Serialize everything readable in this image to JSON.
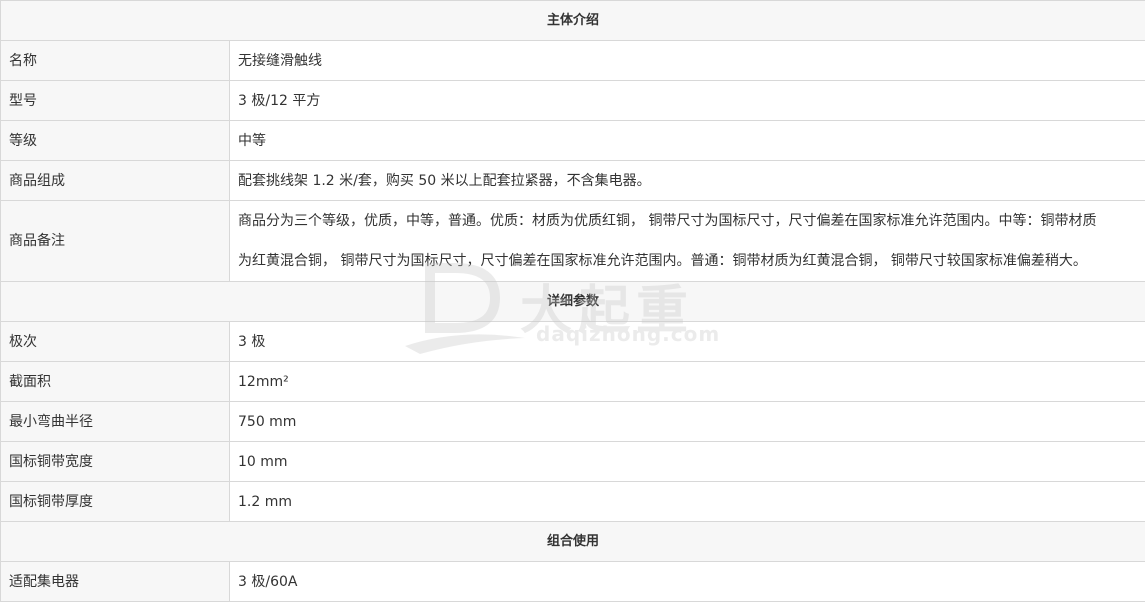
{
  "sections": {
    "intro_title": "主体介绍",
    "params_title": "详细参数",
    "combo_title": "组合使用"
  },
  "intro": {
    "name_label": "名称",
    "name_value": "无接缝滑触线",
    "model_label": "型号",
    "model_value": "3 极/12 平方",
    "grade_label": "等级",
    "grade_value": "中等",
    "composition_label": "商品组成",
    "composition_value": "配套挑线架 1.2 米/套，购买 50 米以上配套拉紧器，不含集电器。",
    "remarks_label": "商品备注",
    "remarks_line1": "商品分为三个等级，优质，中等，普通。优质：材质为优质红铜， 铜带尺寸为国标尺寸，尺寸偏差在国家标准允许范围内。中等：铜带材质",
    "remarks_line2": "为红黄混合铜， 铜带尺寸为国标尺寸，尺寸偏差在国家标准允许范围内。普通：铜带材质为红黄混合铜， 铜带尺寸较国家标准偏差稍大。"
  },
  "params": {
    "poles_label": "极次",
    "poles_value": "3 极",
    "section_label": "截面积",
    "section_value": "12mm²",
    "bend_label": "最小弯曲半径",
    "bend_value": "750 mm",
    "width_label": "国标铜带宽度",
    "width_value": "10 mm",
    "thickness_label": "国标铜带厚度",
    "thickness_value": "1.2 mm"
  },
  "combo": {
    "collector_label": "适配集电器",
    "collector_value": "3 极/60A"
  },
  "watermark": {
    "brand_cn": "大起重",
    "brand_url": "daqizhong.com"
  }
}
